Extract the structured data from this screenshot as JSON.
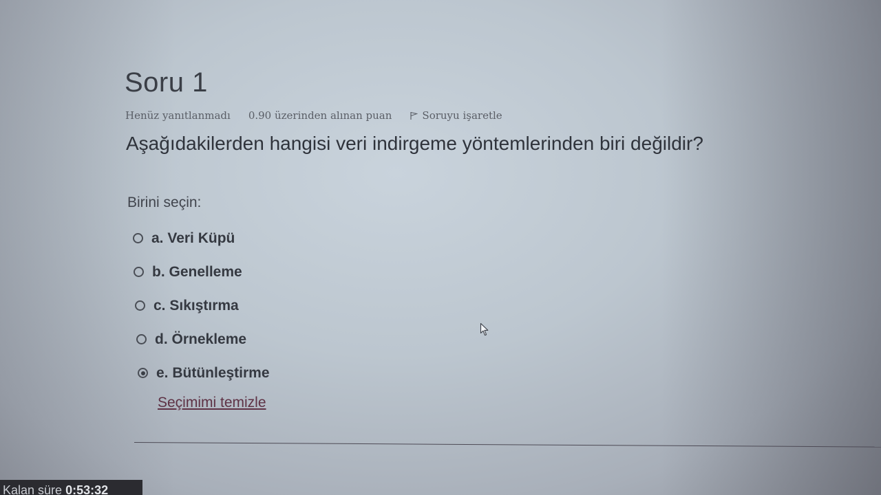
{
  "question": {
    "title": "Soru 1",
    "state": "Henüz yanıtlanmadı",
    "grade": "0.90 üzerinden alınan puan",
    "flag_label": "Soruyu işaretle",
    "text": "Aşağıdakilerden hangisi veri indirgeme yöntemlerinden biri değildir?",
    "prompt": "Birini seçin:",
    "answers": [
      {
        "label": "a. Veri Küpü",
        "selected": false
      },
      {
        "label": "b. Genelleme",
        "selected": false
      },
      {
        "label": "c. Sıkıştırma",
        "selected": false
      },
      {
        "label": "d. Örnekleme",
        "selected": false
      },
      {
        "label": "e. Bütünleştirme",
        "selected": true
      }
    ],
    "clear_label": "Seçimimi temizle"
  },
  "timer": {
    "label": "Kalan süre",
    "value": "0:53:32"
  }
}
